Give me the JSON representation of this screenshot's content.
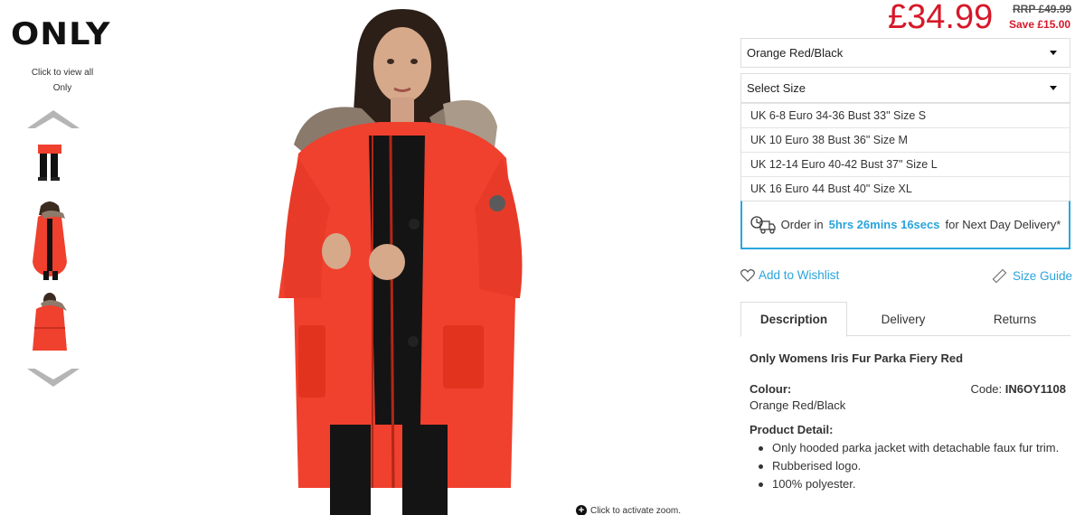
{
  "brand": {
    "logo_text": "ONLY",
    "view_all_line1": "Click to view all",
    "view_all_line2": "Only"
  },
  "product": {
    "price": "£34.99",
    "rrp": "RRP £49.99",
    "save": "Save £15.00",
    "colour_select": "Orange Red/Black",
    "size_select": "Select Size",
    "size_options": [
      "UK 6-8 Euro 34-36 Bust 33\" Size S",
      "UK 10 Euro 38 Bust 36\" Size M",
      "UK 12-14 Euro 40-42 Bust 37\" Size L",
      "UK 16 Euro 44 Bust 40\" Size XL"
    ],
    "delivery": {
      "prefix": "Order in",
      "countdown": "5hrs 26mins 16secs",
      "suffix": "for Next Day Delivery*"
    },
    "wishlist": "Add to Wishlist",
    "size_guide": "Size Guide",
    "tabs": [
      "Description",
      "Delivery",
      "Returns"
    ],
    "title": "Only Womens Iris Fur Parka Fiery Red",
    "colour_label": "Colour:",
    "colour_value": "Orange Red/Black",
    "code_label": "Code:",
    "code_value": "IN6OY1108",
    "detail_title": "Product Detail:",
    "details": [
      "Only hooded parka jacket with detachable faux fur trim.",
      "Rubberised logo.",
      "100% polyester."
    ]
  },
  "zoom_hint": "Click to activate zoom.",
  "colors": {
    "accent_blue": "#2aa4dc",
    "price_red": "#d6182a",
    "jacket": "#f0402e"
  }
}
